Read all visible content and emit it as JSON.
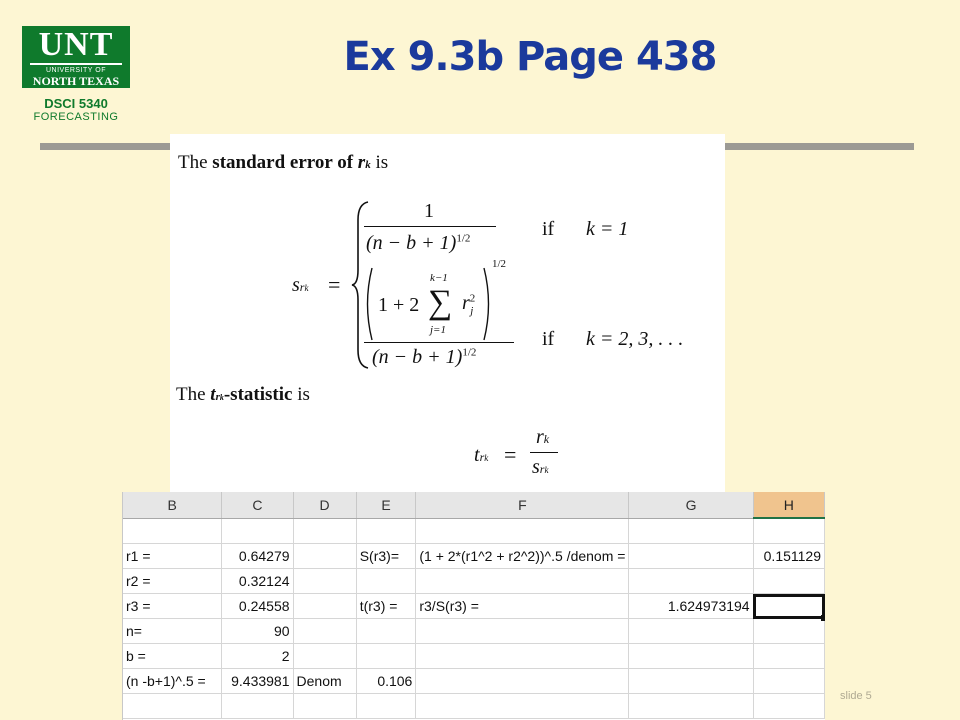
{
  "logo": {
    "main": "UNT",
    "line1": "UNIVERSITY OF",
    "line2": "NORTH TEXAS"
  },
  "course": {
    "code": "DSCI 5340",
    "name": "FORECASTING"
  },
  "title": "Ex 9.3b Page 438",
  "slide_number": "slide 5",
  "formula": {
    "se_intro_prefix": "The ",
    "se_intro_bold": "standard error of ",
    "se_intro_var": "r",
    "se_intro_sub": "k",
    "se_intro_suffix": " is",
    "s": "s",
    "s_sub": "r",
    "s_subsub": "k",
    "eq": "=",
    "one": "1",
    "denom": "(n − b + 1)",
    "half_exp": "1/2",
    "case1_if": "if",
    "case1_cond": "k = 1",
    "sum_expr": "1 + 2",
    "sigma": "∑",
    "sum_upper": "k−1",
    "sum_lower": "j=1",
    "r": "r",
    "r_sup": "2",
    "r_sub": "j",
    "case2_if": "if",
    "case2_cond": "k = 2, 3, . . .",
    "t_intro_prefix": "The ",
    "t_intro_var": "t",
    "t_intro_sub": "r",
    "t_intro_subsub": "k",
    "t_intro_bold": "-statistic",
    "t_intro_suffix": " is",
    "t": "t",
    "frac_num": "r",
    "frac_num_sub": "k",
    "frac_den": "s",
    "frac_den_sub": "r",
    "frac_den_subsub": "k"
  },
  "spreadsheet": {
    "columns": [
      "B",
      "C",
      "D",
      "E",
      "F",
      "G",
      "H"
    ],
    "selected_column": "H",
    "rows": [
      [
        "",
        "",
        "",
        "",
        "",
        "",
        ""
      ],
      [
        "r1 =",
        "0.64279",
        "",
        "S(r3)=",
        "(1 + 2*(r1^2 + r2^2))^.5 /denom =",
        "",
        "0.151129"
      ],
      [
        "r2 =",
        "0.32124",
        "",
        "",
        "",
        "",
        ""
      ],
      [
        "r3 =",
        "0.24558",
        "",
        "t(r3) =",
        "r3/S(r3) =",
        "1.624973194",
        ""
      ],
      [
        "n=",
        "90",
        "",
        "",
        "",
        "",
        ""
      ],
      [
        "b =",
        "2",
        "",
        "",
        "",
        "",
        ""
      ],
      [
        "(n -b+1)^.5 =",
        "9.433981",
        "Denom",
        "0.106",
        "",
        "",
        ""
      ],
      [
        "",
        "",
        "",
        "",
        "",
        "",
        ""
      ]
    ]
  }
}
